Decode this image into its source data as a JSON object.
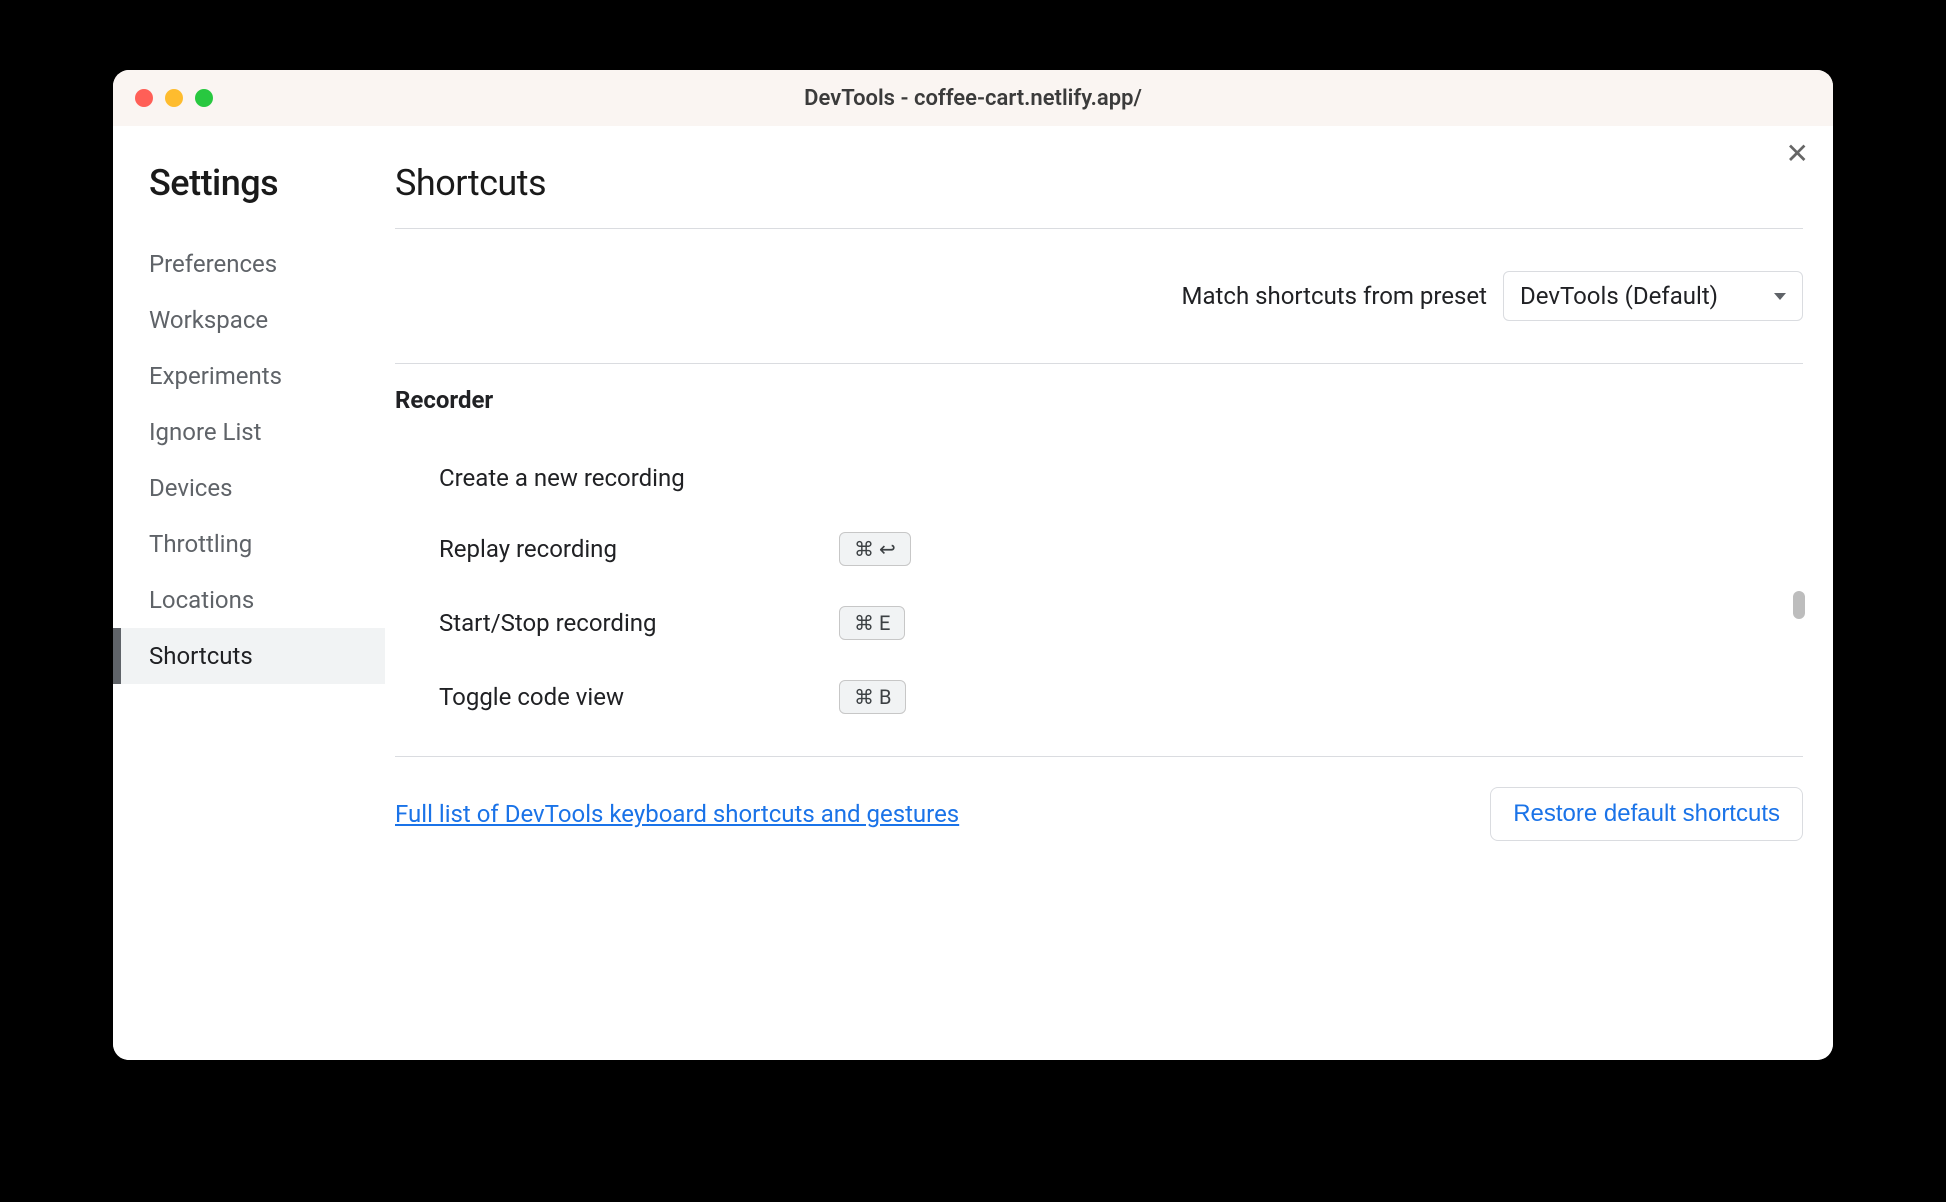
{
  "window": {
    "title": "DevTools - coffee-cart.netlify.app/"
  },
  "sidebar": {
    "title": "Settings",
    "items": [
      {
        "label": "Preferences"
      },
      {
        "label": "Workspace"
      },
      {
        "label": "Experiments"
      },
      {
        "label": "Ignore List"
      },
      {
        "label": "Devices"
      },
      {
        "label": "Throttling"
      },
      {
        "label": "Locations"
      },
      {
        "label": "Shortcuts"
      }
    ]
  },
  "main": {
    "title": "Shortcuts",
    "preset_label": "Match shortcuts from preset",
    "preset_value": "DevTools (Default)",
    "section_title": "Recorder",
    "rows": [
      {
        "label": "Create a new recording",
        "keys": ""
      },
      {
        "label": "Replay recording",
        "keys": "⌘  ↩"
      },
      {
        "label": "Start/Stop recording",
        "keys": "⌘  E"
      },
      {
        "label": "Toggle code view",
        "keys": "⌘  B"
      }
    ],
    "full_list_link": "Full list of DevTools keyboard shortcuts and gestures",
    "restore_button": "Restore default shortcuts",
    "close_glyph": "✕"
  }
}
